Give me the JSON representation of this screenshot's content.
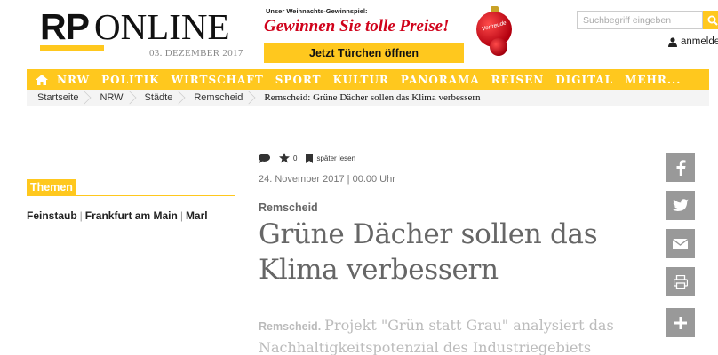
{
  "header": {
    "logo_rp": "RP",
    "logo_online": "ONLINE",
    "date": "03. DEZEMBER 2017",
    "promo": {
      "kicker": "Unser Weihnachts-Gewinnspiel:",
      "title": "Gewinnen Sie tolle Preise!",
      "button": "Jetzt Türchen öffnen",
      "ornament_label": "Vorfreude"
    },
    "search_placeholder": "Suchbegriff eingeben",
    "login": "anmelden"
  },
  "nav": {
    "items": [
      "NRW",
      "POLITIK",
      "WIRTSCHAFT",
      "SPORT",
      "KULTUR",
      "PANORAMA",
      "REISEN",
      "DIGITAL",
      "MEHR..."
    ]
  },
  "breadcrumb": [
    "Startseite",
    "NRW",
    "Städte",
    "Remscheid"
  ],
  "breadcrumb_current": "Remscheid: Grüne Dächer sollen das Klima verbessern",
  "themen": {
    "label": "Themen",
    "links": [
      "Feinstaub",
      "Frankfurt am Main",
      "Marl"
    ]
  },
  "article": {
    "rating_count": "0",
    "read_later": "später lesen",
    "date": "24. November 2017 | 00.00 Uhr",
    "kicker": "Remscheid",
    "headline": "Grüne Dächer sollen das Klima verbessern",
    "teaser_location": "Remscheid.",
    "teaser": "Projekt \"Grün statt Grau\" analysiert das Nachhaltigkeitspotenzial des Industriegebiets"
  },
  "icons": {
    "home": "home-icon",
    "search": "search-icon",
    "user": "user-icon",
    "comment": "comment-icon",
    "star": "star-icon",
    "bookmark": "bookmark-icon",
    "share": [
      "facebook-icon",
      "twitter-icon",
      "email-icon",
      "print-icon",
      "plus-icon"
    ]
  },
  "colors": {
    "accent": "#ffc81e",
    "promo_red": "#d0021b",
    "share_bg": "#999999"
  }
}
